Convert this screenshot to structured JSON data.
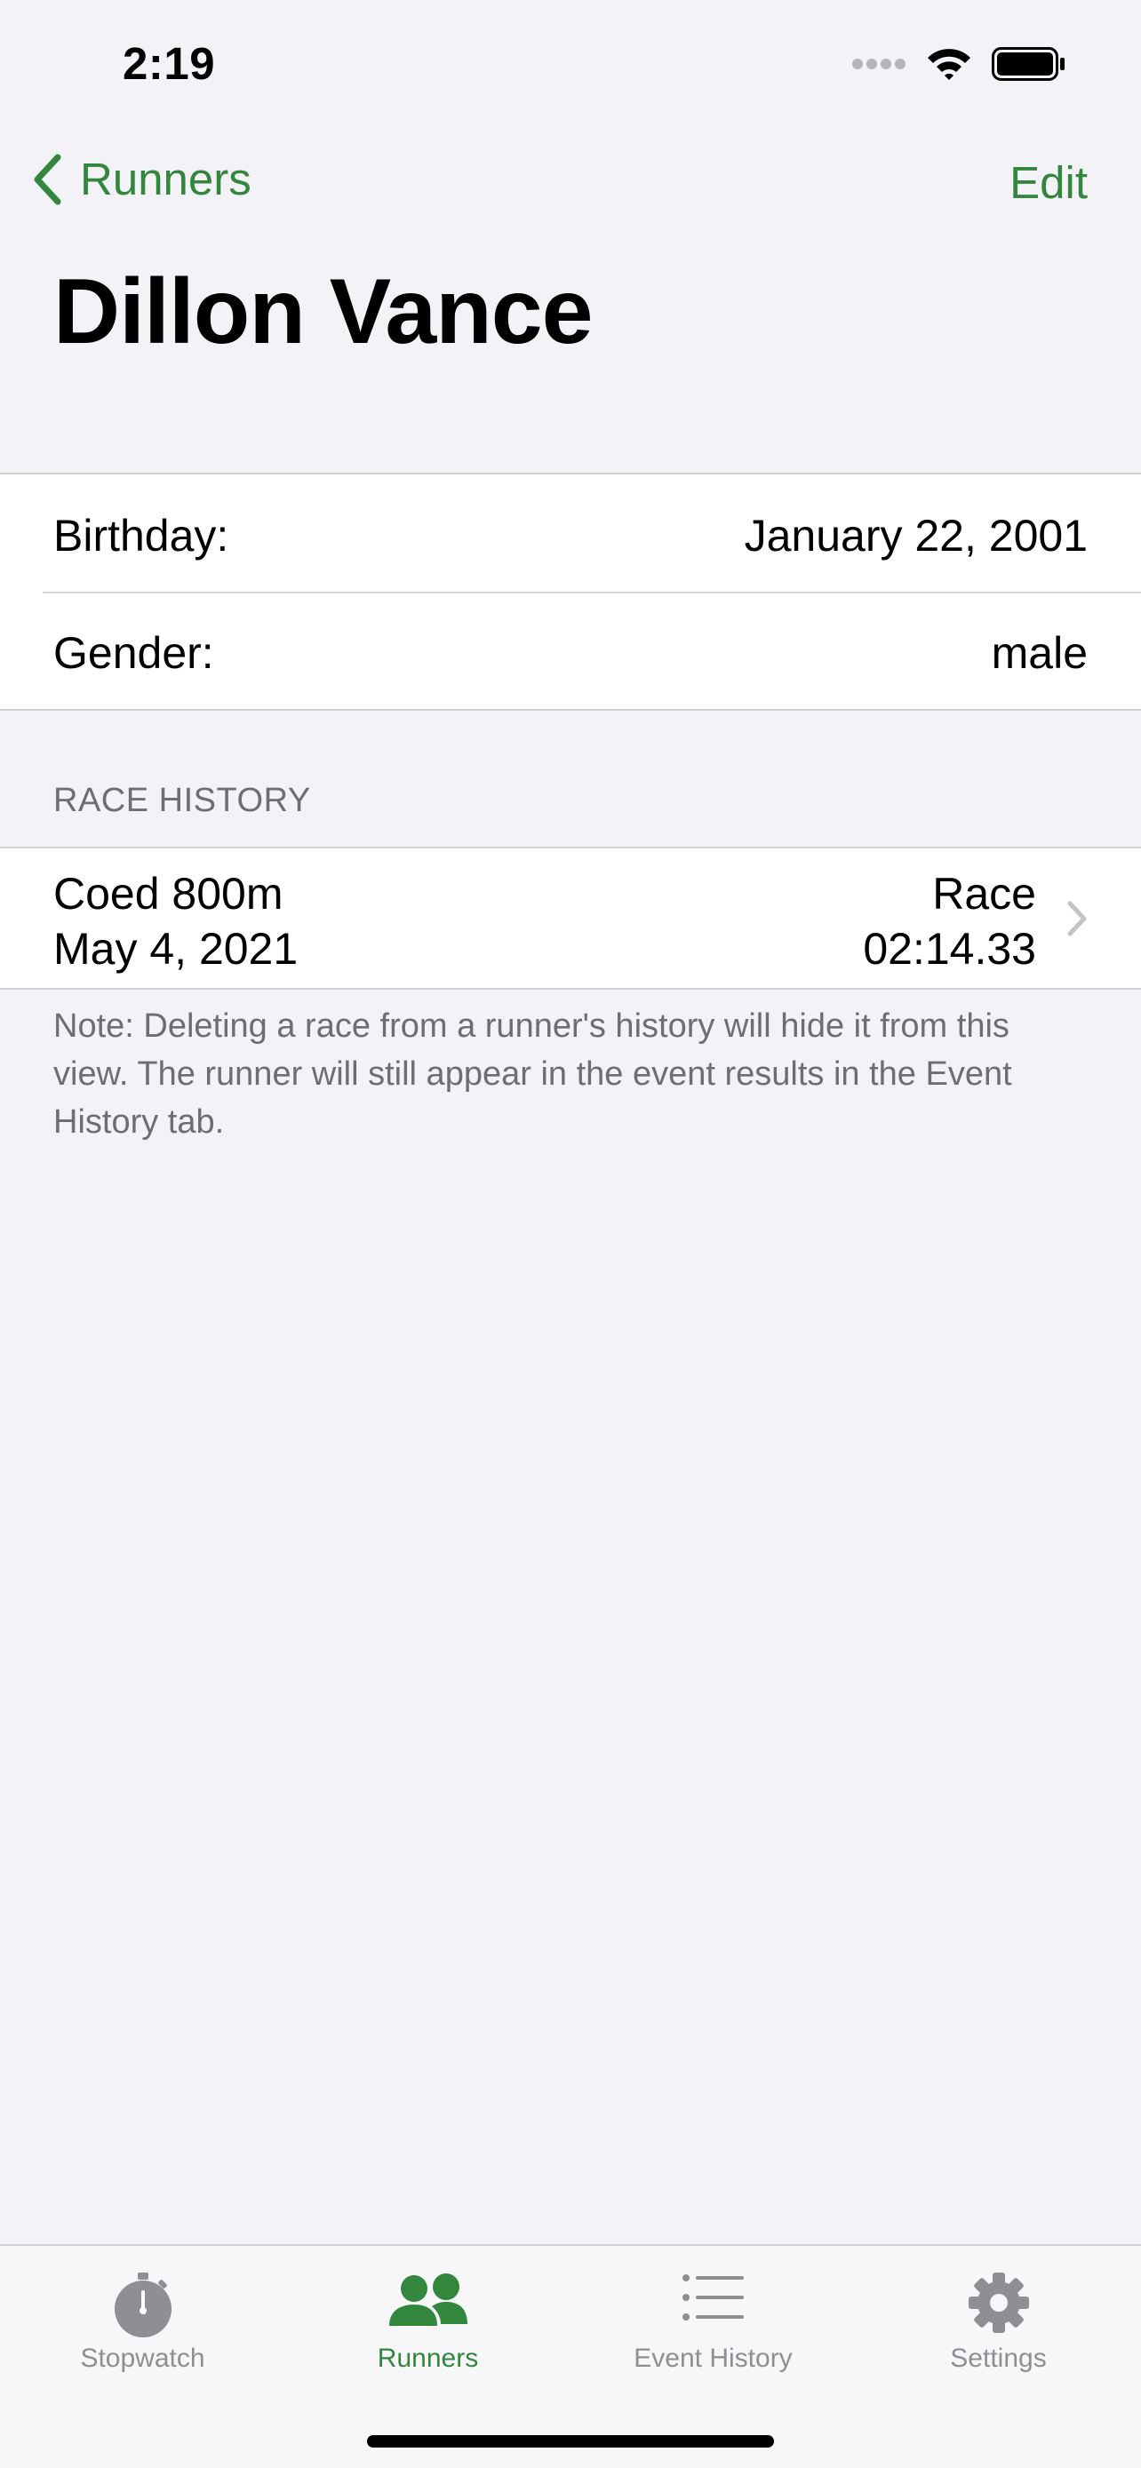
{
  "status_bar": {
    "time": "2:19"
  },
  "nav": {
    "back_label": "Runners",
    "edit_label": "Edit",
    "title": "Dillon Vance"
  },
  "info": {
    "birthday_label": "Birthday:",
    "birthday_value": "January 22, 2001",
    "gender_label": "Gender:",
    "gender_value": "male"
  },
  "race_history": {
    "header": "RACE HISTORY",
    "items": [
      {
        "event": "Coed 800m",
        "date": "May 4, 2021",
        "type": "Race",
        "time": "02:14.33"
      }
    ],
    "note": "Note: Deleting a race from a runner's history will hide it from this view. The runner will still appear in the event results in the Event History tab."
  },
  "tabbar": {
    "tabs": [
      {
        "label": "Stopwatch",
        "icon": "stopwatch-icon",
        "active": false
      },
      {
        "label": "Runners",
        "icon": "runners-icon",
        "active": true
      },
      {
        "label": "Event History",
        "icon": "list-icon",
        "active": false
      },
      {
        "label": "Settings",
        "icon": "gear-icon",
        "active": false
      }
    ]
  },
  "colors": {
    "accent": "#32873D",
    "background": "#F2F2F7",
    "secondary_text": "#6D6D72",
    "tab_inactive": "#8E8E93"
  }
}
